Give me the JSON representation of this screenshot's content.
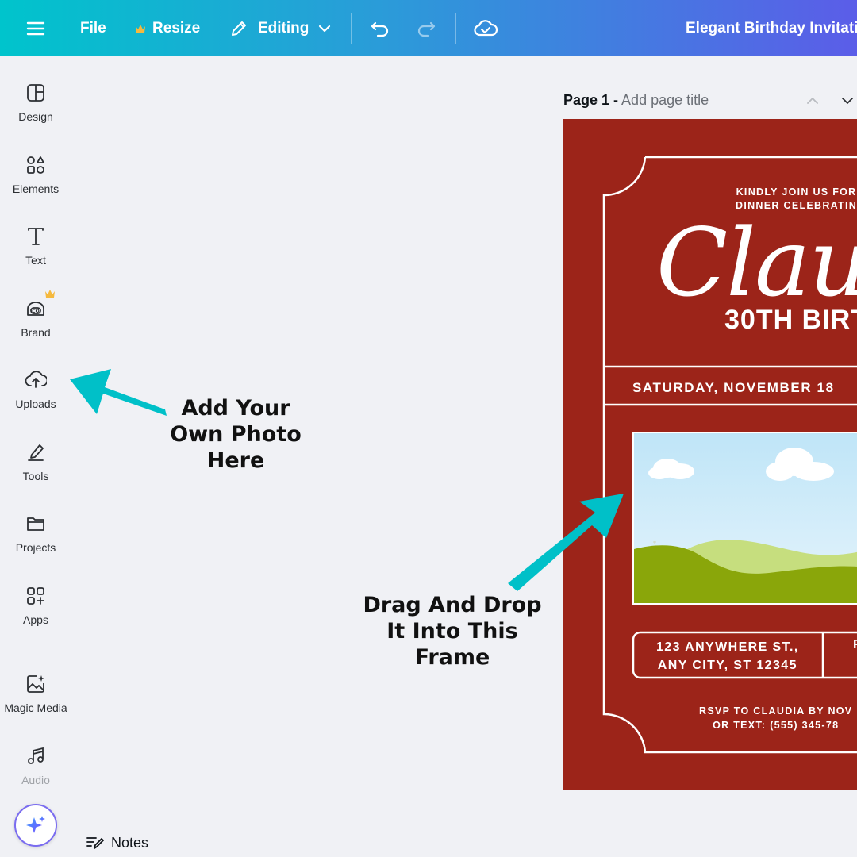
{
  "topbar": {
    "file_label": "File",
    "resize_label": "Resize",
    "editing_label": "Editing",
    "document_title": "Elegant Birthday Invitatio",
    "gradient_colors": [
      "#00c4cc",
      "#5b5de8"
    ],
    "crown_color": "#f5b93e"
  },
  "sidebar": {
    "items": [
      {
        "label": "Design",
        "icon": "design-icon"
      },
      {
        "label": "Elements",
        "icon": "elements-icon"
      },
      {
        "label": "Text",
        "icon": "text-icon"
      },
      {
        "label": "Brand",
        "icon": "brand-icon"
      },
      {
        "label": "Uploads",
        "icon": "uploads-icon"
      },
      {
        "label": "Tools",
        "icon": "tools-icon"
      },
      {
        "label": "Projects",
        "icon": "projects-icon"
      },
      {
        "label": "Apps",
        "icon": "apps-icon"
      },
      {
        "label": "Magic Media",
        "icon": "magic-media-icon"
      },
      {
        "label": "Audio",
        "icon": "audio-icon"
      }
    ]
  },
  "page": {
    "number_label": "Page 1 -",
    "title_placeholder": "Add page title"
  },
  "notes_label": "Notes",
  "invitation": {
    "kindly_line1": "KINDLY JOIN US FOR",
    "kindly_line2": "DINNER CELEBRATIN",
    "name_script": "Claudi",
    "birthday_line": "30TH BIRT",
    "date_line": "SATURDAY, NOVEMBER 18",
    "address_line1": "123 ANYWHERE ST.,",
    "address_line2": "ANY CITY, ST 12345",
    "address_right": "F",
    "rsvp_line1": "RSVP TO CLAUDIA BY NOV",
    "rsvp_line2": "OR TEXT: (555) 345-78",
    "background_color": "#9c2419"
  },
  "callouts": {
    "uploads_tip": [
      "Add Your",
      "Own Photo",
      "Here"
    ],
    "frame_tip": [
      "Drag And Drop",
      "It Into This",
      "Frame"
    ],
    "arrow_color": "#00c0c8"
  }
}
